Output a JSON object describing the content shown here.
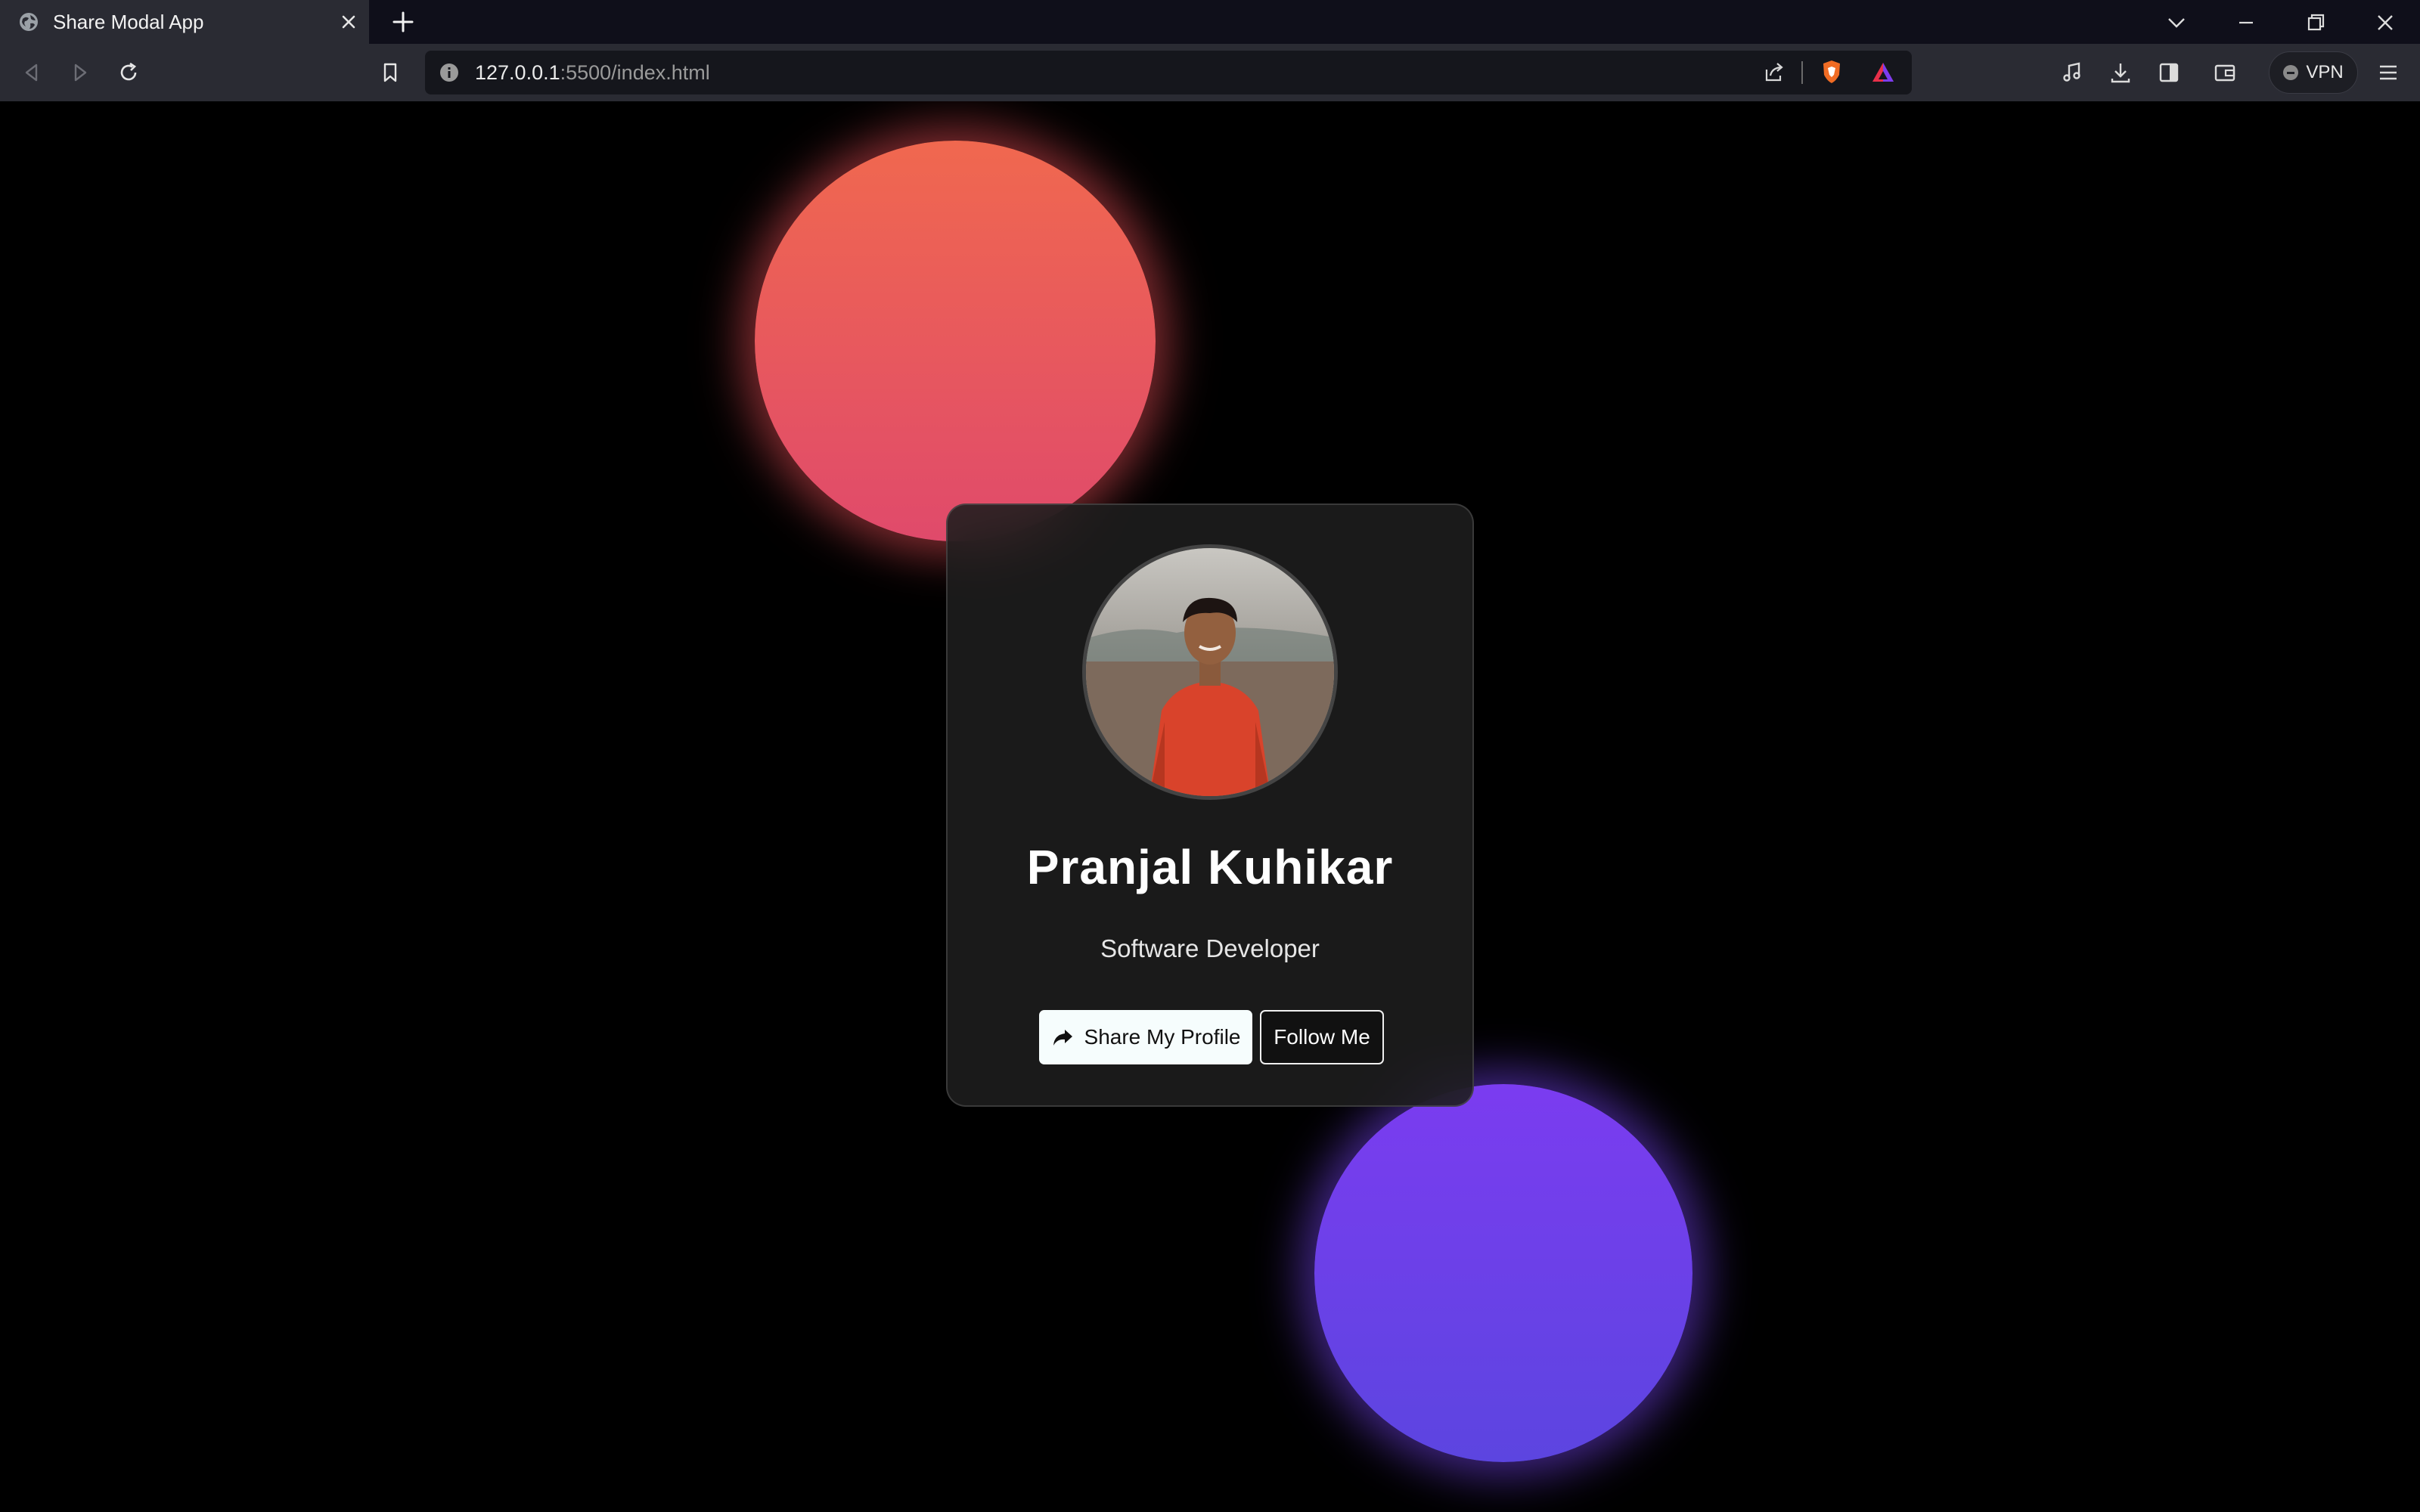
{
  "browser": {
    "tab": {
      "title": "Share Modal App",
      "favicon": "globe-icon",
      "close_icon": "close-icon"
    },
    "new_tab_icon": "plus-icon",
    "window_controls": [
      "chevron-down-icon",
      "minimize-icon",
      "restore-icon",
      "close-icon"
    ],
    "toolbar": {
      "nav_icons": [
        "back-icon",
        "forward-icon",
        "reload-icon",
        "bookmark-icon"
      ],
      "url_host": "127.0.0.1",
      "url_rest": ":5500/index.html",
      "url_bar_icons": [
        "info-icon",
        "share-icon",
        "brave-shields-icon",
        "brave-rewards-icon"
      ],
      "right_icons": [
        "music-icon",
        "download-icon",
        "sidebar-icon",
        "wallet-icon",
        "menu-icon"
      ],
      "vpn_label": "VPN"
    }
  },
  "page": {
    "colors": {
      "orb_top": "#f0684f",
      "orb_bottom": "#5c45e0",
      "card_bg": "#1e1e1e"
    },
    "profile": {
      "name": "Pranjal Kuhikar",
      "role": "Software Developer",
      "avatar": "profile-photo"
    },
    "buttons": {
      "share_label": "Share My Profile",
      "share_icon": "share-arrow-icon",
      "follow_label": "Follow Me"
    }
  }
}
